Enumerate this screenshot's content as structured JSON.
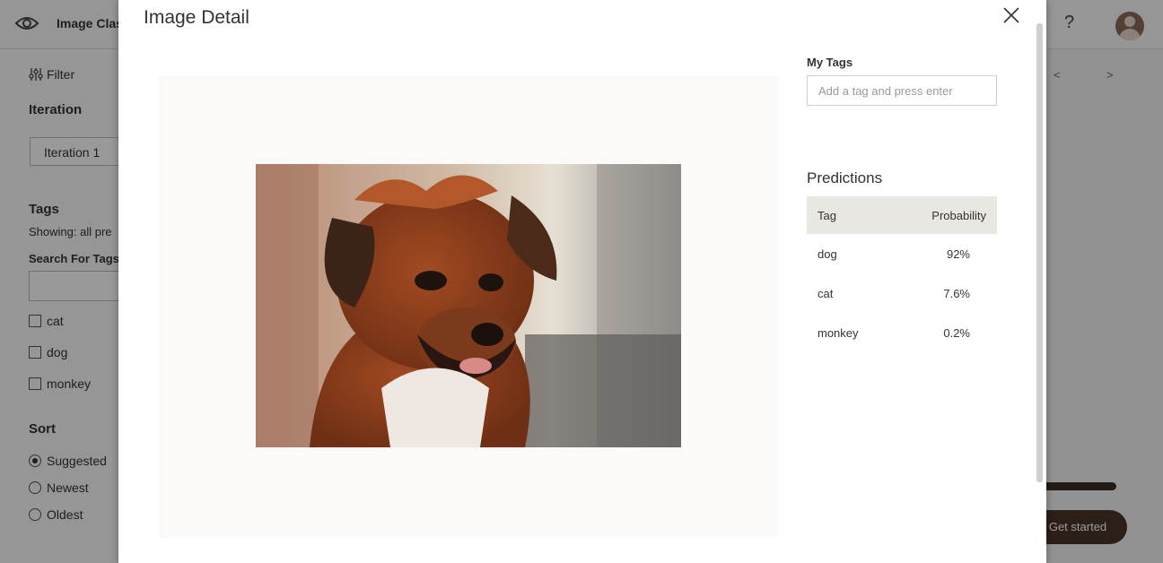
{
  "app": {
    "title": "Image Clas"
  },
  "sidebar": {
    "filter_label": "Filter",
    "iteration_heading": "Iteration",
    "iteration_value": "Iteration 1",
    "tags_heading": "Tags",
    "showing_text": "Showing: all pre",
    "search_label": "Search For Tags:",
    "tags": [
      "cat",
      "dog",
      "monkey"
    ],
    "sort_heading": "Sort",
    "sort_options": [
      "Suggested",
      "Newest",
      "Oldest"
    ],
    "sort_selected": "Suggested"
  },
  "background": {
    "pager_prev": "<",
    "pager_next": ">",
    "get_started_label": "Get started",
    "help_icon_label": "?"
  },
  "modal": {
    "title": "Image Detail",
    "my_tags_label": "My Tags",
    "tag_input_placeholder": "Add a tag and press enter",
    "predictions_title": "Predictions",
    "predictions_columns": [
      "Tag",
      "Probability"
    ],
    "predictions": [
      {
        "tag": "dog",
        "probability": "92%"
      },
      {
        "tag": "cat",
        "probability": "7.6%"
      },
      {
        "tag": "monkey",
        "probability": "0.2%"
      }
    ]
  },
  "icons": {
    "logo": "eye-icon",
    "filter": "sliders-icon",
    "close": "close-icon",
    "help": "question-icon",
    "avatar": "user-avatar-icon"
  },
  "colors": {
    "accent_dark": "#4a3428",
    "table_header_bg": "#e9e7e2",
    "overlay": "rgba(0,0,0,0.4)"
  }
}
